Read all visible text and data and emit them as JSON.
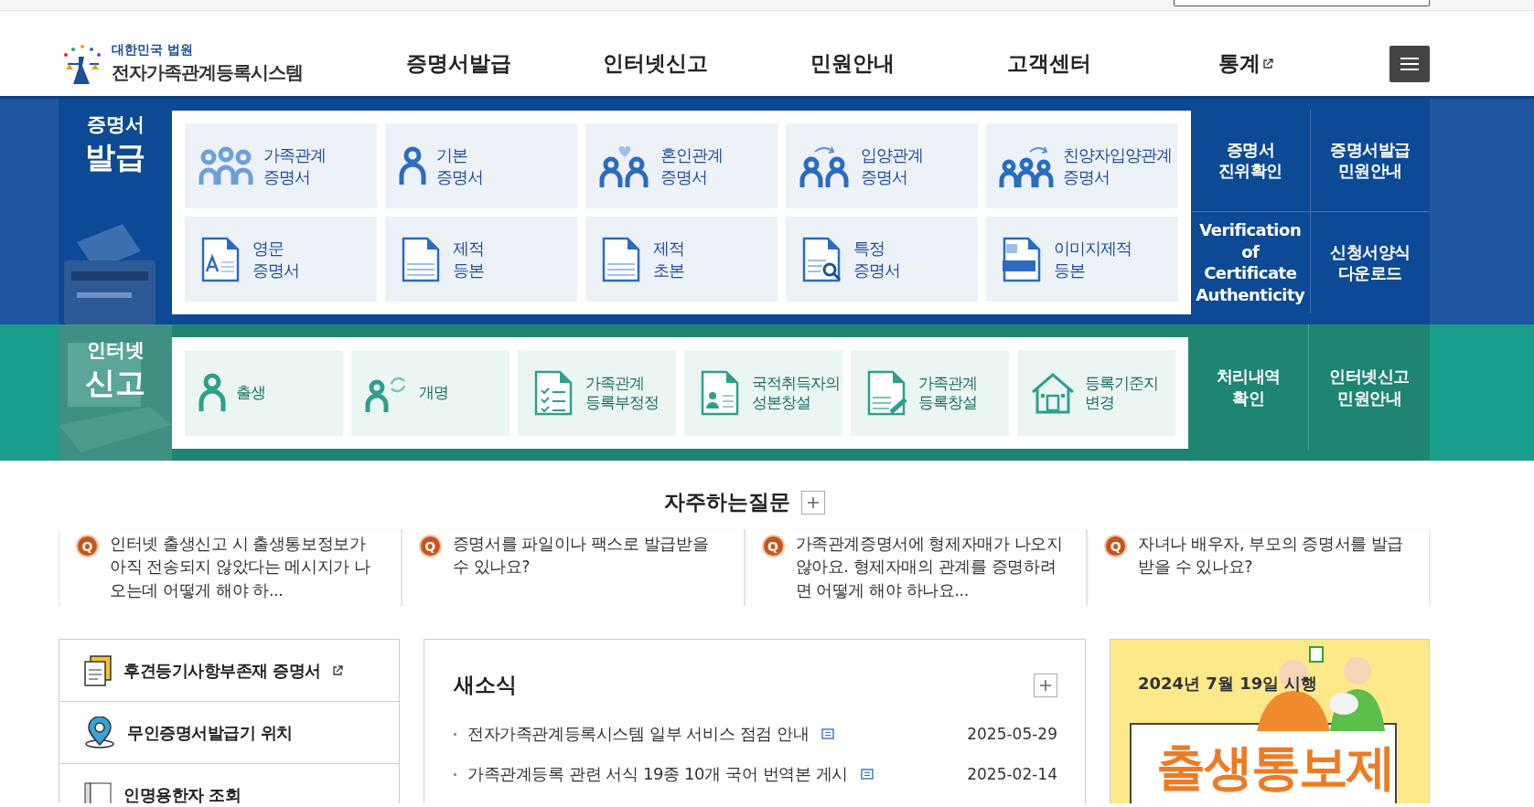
{
  "header": {
    "org": "대한민국 법원",
    "system": "전자가족관계등록시스템",
    "nav": [
      {
        "label": "증명서발급",
        "external": false
      },
      {
        "label": "인터넷신고",
        "external": false
      },
      {
        "label": "민원안내",
        "external": false
      },
      {
        "label": "고객센터",
        "external": false
      },
      {
        "label": "통계",
        "external": true
      }
    ]
  },
  "certificates": {
    "title": [
      "증명서",
      "발급"
    ],
    "tiles": [
      {
        "label": "가족관계\n증명서"
      },
      {
        "label": "기본\n증명서"
      },
      {
        "label": "혼인관계\n증명서"
      },
      {
        "label": "입양관계\n증명서"
      },
      {
        "label": "친양자입양관계\n증명서"
      },
      {
        "label": "영문\n증명서"
      },
      {
        "label": "제적\n등본"
      },
      {
        "label": "제적\n초본"
      },
      {
        "label": "특정\n증명서"
      },
      {
        "label": "이미지제적\n등본"
      }
    ],
    "links": [
      "증명서\n진위확인",
      "증명서발급\n민원안내",
      "Verification of\nCertificate\nAuthenticity",
      "신청서양식\n다운로드"
    ]
  },
  "reports": {
    "title": [
      "인터넷",
      "신고"
    ],
    "tiles": [
      {
        "label": "출생"
      },
      {
        "label": "개명"
      },
      {
        "label": "가족관계\n등록부정정"
      },
      {
        "label": "국적취득자의\n성본창설"
      },
      {
        "label": "가족관계\n등록창설"
      },
      {
        "label": "등록기준지\n변경"
      }
    ],
    "links": [
      "처리내역\n확인",
      "인터넷신고\n민원안내"
    ]
  },
  "faq": {
    "title": "자주하는질문",
    "items": [
      {
        "badge": "Q",
        "text": "인터넷 출생신고 시 출생통보정보가 아직 전송되지 않았다는 메시지가 나오는데 어떻게 해야 하..."
      },
      {
        "badge": "Q",
        "text": "증명서를 파일이나 팩스로 발급받을 수 있나요?"
      },
      {
        "badge": "Q",
        "text": "가족관계증명서에 형제자매가 나오지 않아요. 형제자매의 관계를 증명하려면 어떻게 해야 하나요..."
      },
      {
        "badge": "Q",
        "text": "자녀나 배우자, 부모의 증명서를 발급 받을 수 있나요?"
      }
    ]
  },
  "quick_links": [
    {
      "label": "후견등기사항부존재 증명서",
      "external": true
    },
    {
      "label": "무인증명서발급기 위치",
      "external": false
    },
    {
      "label": "인명용한자 조회",
      "external": false
    }
  ],
  "news": {
    "title": "새소식",
    "items": [
      {
        "title": "전자가족관계등록시스템 일부 서비스 점검 안내",
        "date": "2025-05-29"
      },
      {
        "title": "가족관계등록 관련 서식 19종 10개 국어 번역본 게시",
        "date": "2025-02-14"
      }
    ]
  },
  "banner": {
    "date": "2024년 7월 19일 시행",
    "title": "출생통보제"
  }
}
